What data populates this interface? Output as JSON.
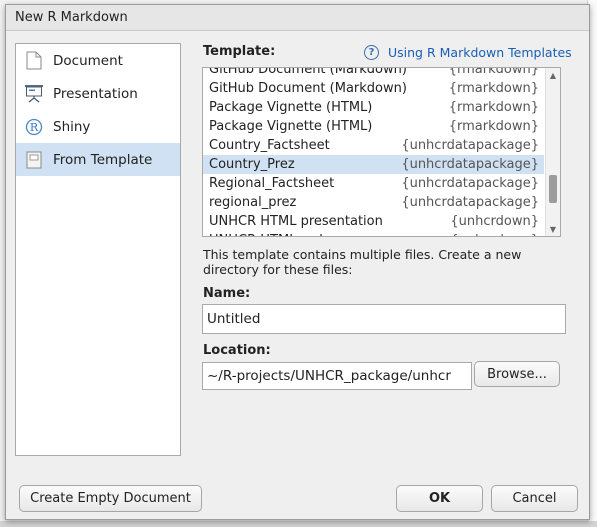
{
  "dialog": {
    "title": "New R Markdown"
  },
  "types": [
    {
      "label": "Document",
      "icon": "document-icon"
    },
    {
      "label": "Presentation",
      "icon": "presentation-icon"
    },
    {
      "label": "Shiny",
      "icon": "shiny-icon"
    },
    {
      "label": "From Template",
      "icon": "template-icon",
      "selected": true
    }
  ],
  "template": {
    "label": "Template:",
    "help_link": "Using R Markdown Templates",
    "items": [
      {
        "name": "GitHub Document (Markdown)",
        "package": "{rmarkdown}"
      },
      {
        "name": "GitHub Document (Markdown)",
        "package": "{rmarkdown}"
      },
      {
        "name": "Package Vignette (HTML)",
        "package": "{rmarkdown}"
      },
      {
        "name": "Package Vignette (HTML)",
        "package": "{rmarkdown}"
      },
      {
        "name": "Country_Factsheet",
        "package": "{unhcrdatapackage}"
      },
      {
        "name": "Country_Prez",
        "package": "{unhcrdatapackage}",
        "selected": true
      },
      {
        "name": "Regional_Factsheet",
        "package": "{unhcrdatapackage}"
      },
      {
        "name": "regional_prez",
        "package": "{unhcrdatapackage}"
      },
      {
        "name": "UNHCR HTML presentation",
        "package": "{unhcrdown}"
      },
      {
        "name": "UNHCR HTML webpage",
        "package": "{unhcrdown}"
      }
    ]
  },
  "info": "This template contains multiple files. Create a new directory for these files:",
  "name": {
    "label": "Name:",
    "value": "Untitled"
  },
  "location": {
    "label": "Location:",
    "value": "~/R-projects/UNHCR_package/unhcr",
    "browse": "Browse..."
  },
  "footer": {
    "create_empty": "Create Empty Document",
    "ok": "OK",
    "cancel": "Cancel"
  }
}
